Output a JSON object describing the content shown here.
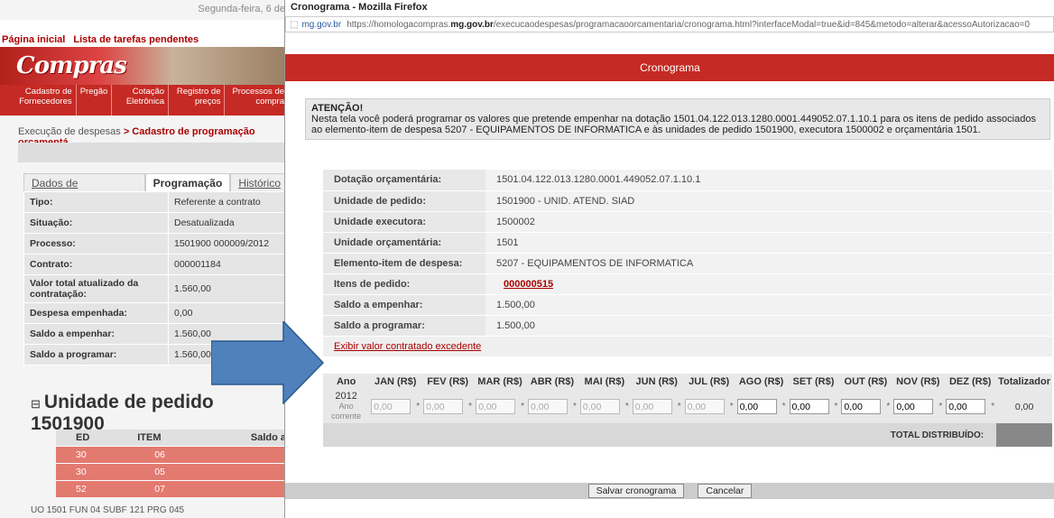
{
  "background": {
    "date": "Segunda-feira, 6 de",
    "links": [
      "Página inicial",
      "Lista de tarefas pendentes"
    ],
    "logo": "Compras",
    "menu": [
      "Cadastro de Fornecedores",
      "Pregão",
      "Cotação Eletrônica",
      "Registro de preços",
      "Processos de compra"
    ],
    "breadcrumb_prefix": "Execução de despesas",
    "breadcrumb_current": "> Cadastro de programação orçamentá",
    "tabs": [
      "Dados de identificação",
      "Programação",
      "Histórico"
    ],
    "fields": [
      {
        "label": "Tipo:",
        "value": "Referente a contrato"
      },
      {
        "label": "Situação:",
        "value": "Desatualizada"
      },
      {
        "label": "Processo:",
        "value": "1501900 000009/2012"
      },
      {
        "label": "Contrato:",
        "value": "000001184"
      },
      {
        "label": "Valor total atualizado da contratação:",
        "value": "1.560,00"
      },
      {
        "label": "Despesa empenhada:",
        "value": "0,00"
      },
      {
        "label": "Saldo a empenhar:",
        "value": "1.560,00"
      },
      {
        "label": "Saldo a programar:",
        "value": "1.560,00"
      }
    ],
    "unidade_title": "Unidade de pedido 1501900",
    "items_headers": [
      "ED",
      "ITEM",
      "Saldo a"
    ],
    "items": [
      [
        "30",
        "06"
      ],
      [
        "30",
        "05"
      ],
      [
        "52",
        "07"
      ]
    ],
    "footer": "UO 1501   FUN 04   SUBF 121   PRG 045"
  },
  "window": {
    "title": "Cronograma - Mozilla Firefox",
    "site": "mg.gov.br",
    "url_prefix": "https://homologacompras.",
    "url_host": "mg.gov.br",
    "url_rest": "/execucaodespesas/programacaoorcamentaria/cronograma.html?interfaceModal=true&id=845&metodo=alterar&acessoAutorizacao=0",
    "header": "Cronograma",
    "attention_title": "ATENÇÃO!",
    "attention_text": "Nesta tela você poderá programar os valores que pretende empenhar na dotação 1501.04.122.013.1280.0001.449052.07.1.10.1 para os itens de pedido associados ao elemento-item de despesa 5207 - EQUIPAMENTOS DE INFORMATICA e às unidades de pedido 1501900, executora 1500002 e orçamentária 1501.",
    "info": [
      {
        "label": "Dotação orçamentária:",
        "value": "1501.04.122.013.1280.0001.449052.07.1.10.1"
      },
      {
        "label": "Unidade de pedido:",
        "value": "1501900 - UNID. ATEND. SIAD"
      },
      {
        "label": "Unidade executora:",
        "value": "1500002"
      },
      {
        "label": "Unidade orçamentária:",
        "value": "1501"
      },
      {
        "label": "Elemento-item de despesa:",
        "value": "5207 - EQUIPAMENTOS DE INFORMATICA"
      },
      {
        "label": "Itens de pedido:",
        "value": "000000515"
      },
      {
        "label": "Saldo a empenhar:",
        "value": "1.500,00"
      },
      {
        "label": "Saldo a programar:",
        "value": "1.500,00"
      }
    ],
    "excedente_link": "Exibir valor contratado excedente",
    "table": {
      "headers": [
        "Ano",
        "JAN (R$)",
        "FEV (R$)",
        "MAR (R$)",
        "ABR (R$)",
        "MAI (R$)",
        "JUN (R$)",
        "JUL (R$)",
        "AGO (R$)",
        "SET (R$)",
        "OUT (R$)",
        "NOV (R$)",
        "DEZ (R$)",
        "Totalizador"
      ],
      "year": "2012",
      "year_note": "Ano corrente",
      "months": [
        "0,00",
        "0,00",
        "0,00",
        "0,00",
        "0,00",
        "0,00",
        "0,00",
        "0,00",
        "0,00",
        "0,00",
        "0,00",
        "0,00"
      ],
      "total": "0,00",
      "total_label": "TOTAL DISTRIBUÍDO:"
    },
    "buttons": {
      "save": "Salvar cronograma",
      "cancel": "Cancelar"
    }
  }
}
